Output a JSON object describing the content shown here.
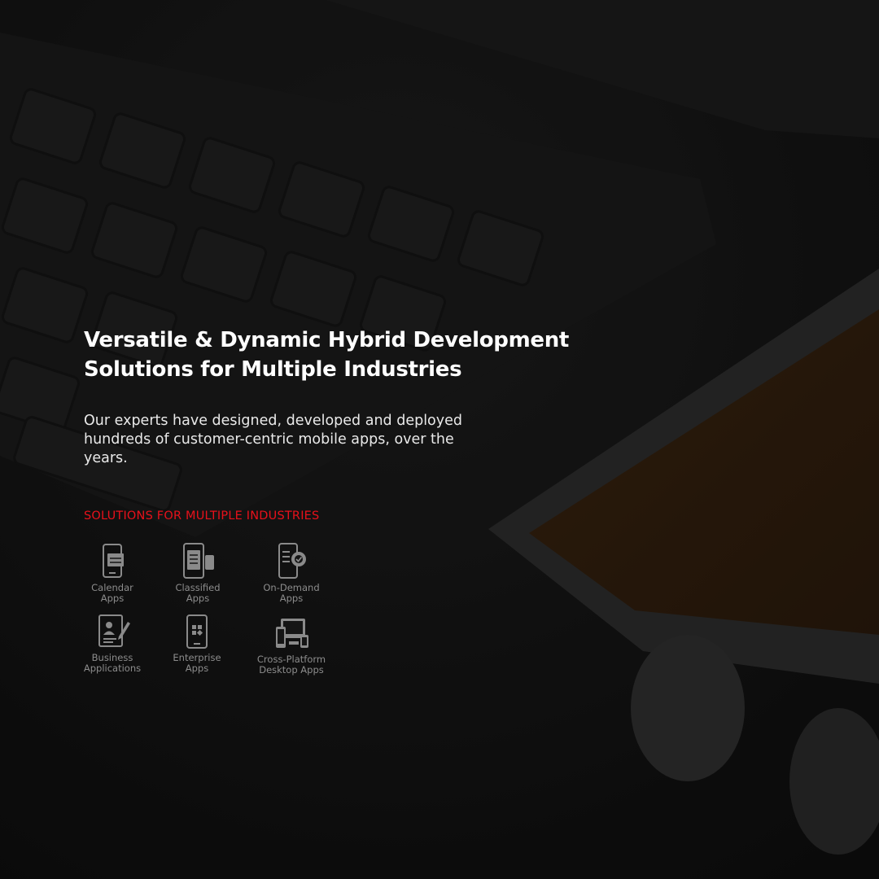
{
  "hero": {
    "title_lines": [
      "Versatile & Dynamic Hybrid Development",
      "Solutions for Multiple Industries"
    ],
    "description_lines": [
      "Our experts have designed, developed and deployed",
      "hundreds of customer-centric mobile apps, over the",
      "years."
    ]
  },
  "solutions": {
    "label": "SOLUTIONS FOR MULTIPLE INDUSTRIES",
    "apps": [
      {
        "icon": "calendar-phone-icon",
        "line1": "Calendar",
        "line2": "Apps"
      },
      {
        "icon": "classified-phone-icon",
        "line1": "Classified",
        "line2": "Apps"
      },
      {
        "icon": "on-demand-gear-phone-icon",
        "line1": "On-Demand",
        "line2": "Apps"
      },
      {
        "icon": "business-document-icon",
        "line1": "Business",
        "line2": "Applications"
      },
      {
        "icon": "enterprise-phone-icon",
        "line1": "Enterprise",
        "line2": "Apps"
      },
      {
        "icon": "cross-platform-devices-icon",
        "line1": "Cross-Platform",
        "line2": "Desktop Apps"
      }
    ]
  },
  "colors": {
    "background": "#151515",
    "heading": "#ffffff",
    "accent": "#e8111b",
    "icon": "#8a8a8a"
  }
}
